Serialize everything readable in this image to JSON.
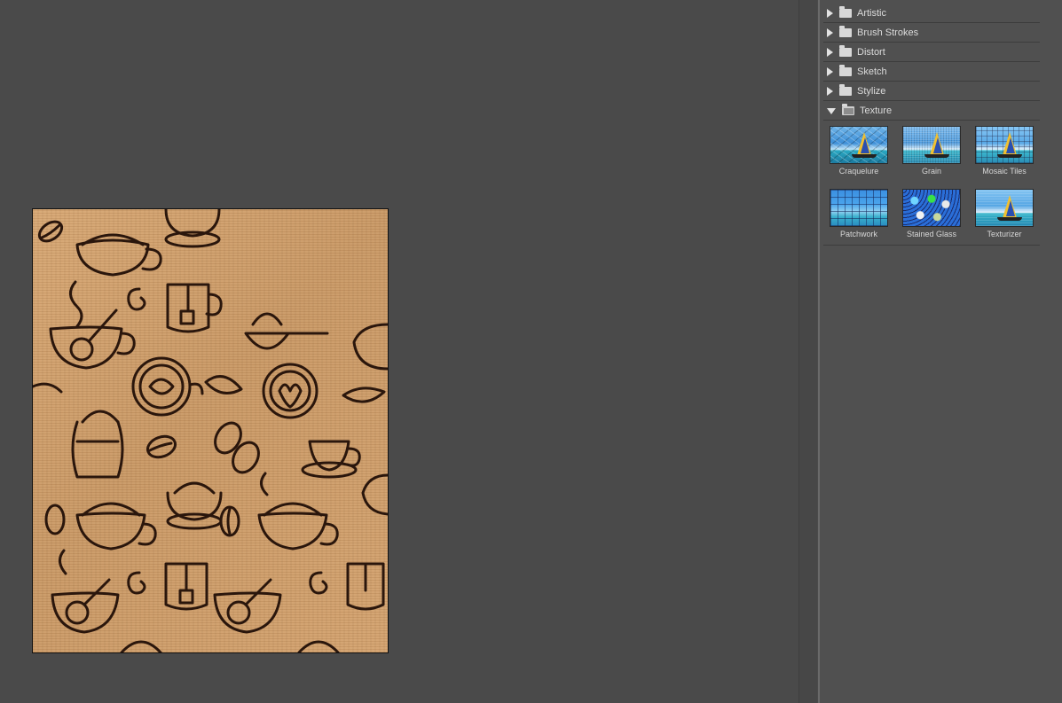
{
  "filter_categories": [
    {
      "label": "Artistic",
      "expanded": false
    },
    {
      "label": "Brush Strokes",
      "expanded": false
    },
    {
      "label": "Distort",
      "expanded": false
    },
    {
      "label": "Sketch",
      "expanded": false
    },
    {
      "label": "Stylize",
      "expanded": false
    },
    {
      "label": "Texture",
      "expanded": true
    }
  ],
  "texture_filters": [
    {
      "label": "Craquelure",
      "selected": false
    },
    {
      "label": "Grain",
      "selected": false
    },
    {
      "label": "Mosaic Tiles",
      "selected": false
    },
    {
      "label": "Patchwork",
      "selected": false
    },
    {
      "label": "Stained Glass",
      "selected": false
    },
    {
      "label": "Texturizer",
      "selected": false
    }
  ],
  "colors": {
    "workspace_bg": "#4a4a4a",
    "panel_bg": "#505050",
    "preview_base": "#cf9f6c",
    "ink": "#2a160c"
  }
}
